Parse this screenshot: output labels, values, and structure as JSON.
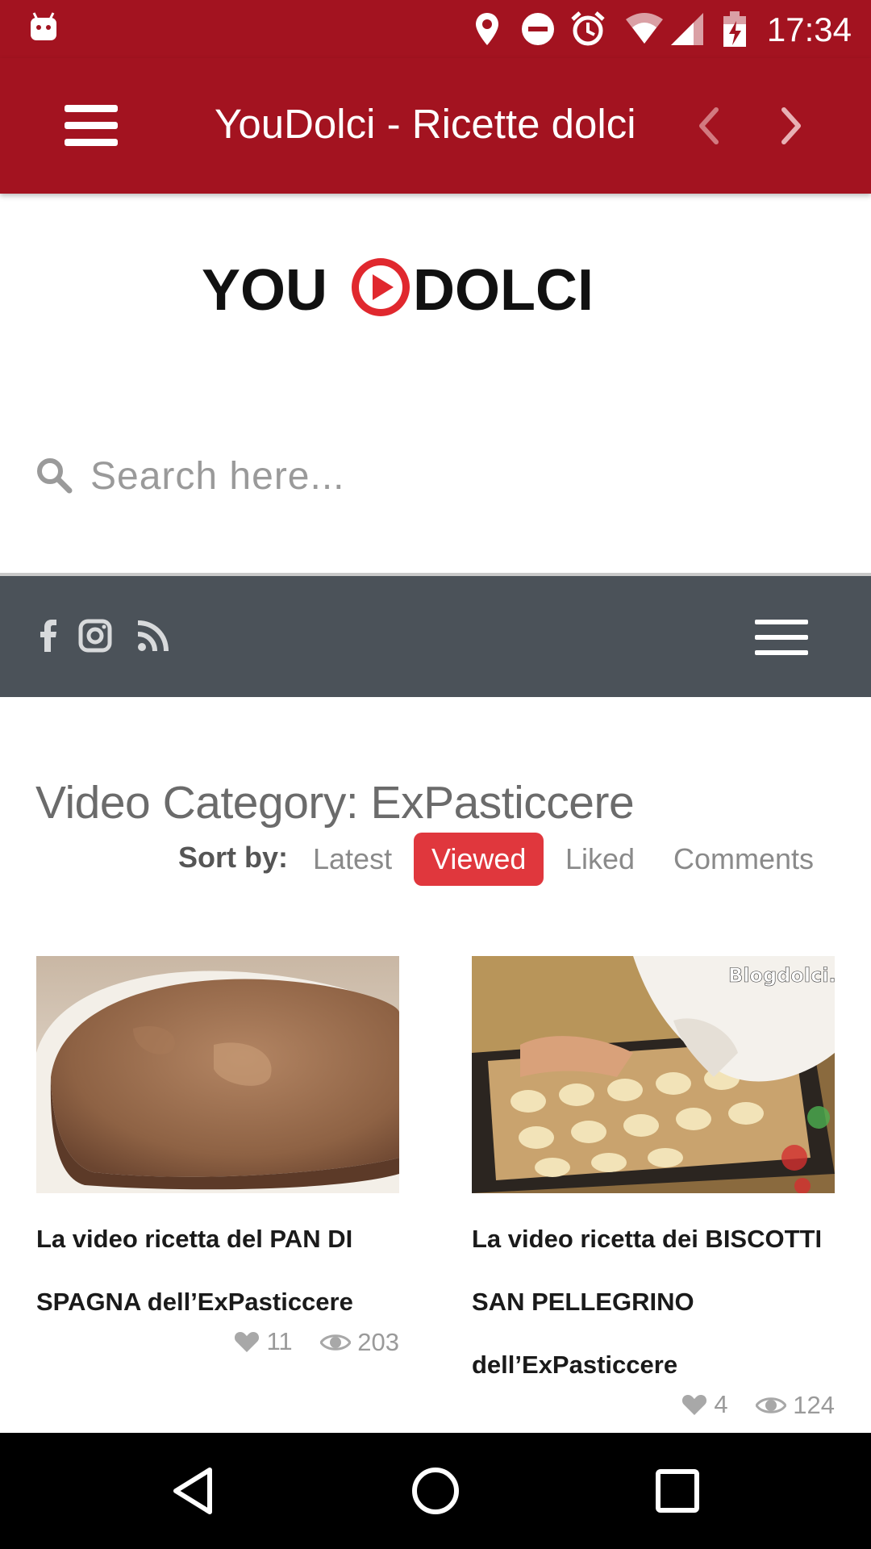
{
  "status_bar": {
    "time": "17:34",
    "icons": [
      "android-notification-icon",
      "location-icon",
      "do-not-disturb-icon",
      "alarm-icon",
      "wifi-icon",
      "cell-signal-icon",
      "battery-charging-icon"
    ]
  },
  "app_bar": {
    "title": "YouDolci - Ricette dolci",
    "menu_icon": "hamburger-menu-icon",
    "back_icon": "chevron-left-icon",
    "forward_icon": "chevron-right-icon"
  },
  "logo": {
    "text_left": "YOU",
    "text_right": "DOLCI",
    "play_color": "#e0282e"
  },
  "search": {
    "placeholder": "Search here..."
  },
  "social_bar": {
    "icons": [
      "facebook-icon",
      "instagram-icon",
      "rss-icon"
    ],
    "menu_icon": "hamburger-menu-icon"
  },
  "category": {
    "heading": "Video Category: ExPasticcere"
  },
  "sort": {
    "label": "Sort by:",
    "options": [
      "Latest",
      "Viewed",
      "Liked",
      "Comments"
    ],
    "selected": "Viewed"
  },
  "videos": [
    {
      "title": "La video ricetta del PAN DI SPAGNA dell’ExPasticcere",
      "likes": "11",
      "views": "203"
    },
    {
      "title": "La video ricetta dei BISCOTTI SAN PELLEGRINO dell’ExPasticcere",
      "watermark": "Blogdolci.co",
      "likes": "4",
      "views": "124"
    }
  ],
  "colors": {
    "app_bar": "#a31320",
    "social_bar": "#4b5259",
    "accent": "#e0373d"
  }
}
